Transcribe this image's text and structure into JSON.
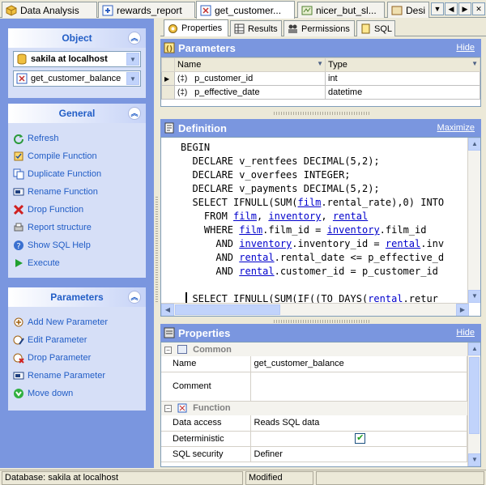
{
  "tabs": [
    {
      "label": "Data Analysis",
      "icon": "cube-icon"
    },
    {
      "label": "rewards_report",
      "icon": "procedure-icon"
    },
    {
      "label": "get_customer...",
      "icon": "function-icon",
      "active": true
    },
    {
      "label": "nicer_but_sl...",
      "icon": "view-icon"
    },
    {
      "label": "Desi",
      "icon": "designer-icon"
    }
  ],
  "sidebar": {
    "object": {
      "title": "Object",
      "database": "sakila at localhost",
      "function": "get_customer_balance"
    },
    "general": {
      "title": "General",
      "items": [
        {
          "label": "Refresh",
          "icon": "refresh-icon"
        },
        {
          "label": "Compile Function",
          "icon": "compile-icon"
        },
        {
          "label": "Duplicate Function",
          "icon": "duplicate-icon"
        },
        {
          "label": "Rename Function",
          "icon": "rename-icon"
        },
        {
          "label": "Drop Function",
          "icon": "drop-icon"
        },
        {
          "label": "Report structure",
          "icon": "report-icon"
        },
        {
          "label": "Show SQL Help",
          "icon": "help-icon"
        },
        {
          "label": "Execute",
          "icon": "execute-icon"
        }
      ]
    },
    "parameters": {
      "title": "Parameters",
      "items": [
        {
          "label": "Add New Parameter",
          "icon": "add-parameter-icon"
        },
        {
          "label": "Edit Parameter",
          "icon": "edit-parameter-icon"
        },
        {
          "label": "Drop Parameter",
          "icon": "drop-parameter-icon"
        },
        {
          "label": "Rename Parameter",
          "icon": "rename-parameter-icon"
        },
        {
          "label": "Move down",
          "icon": "move-down-icon"
        }
      ]
    }
  },
  "subtabs": [
    {
      "label": "Properties",
      "active": true
    },
    {
      "label": "Results"
    },
    {
      "label": "Permissions"
    },
    {
      "label": "SQL"
    }
  ],
  "parameters_section": {
    "title": "Parameters",
    "hide_label": "Hide",
    "columns": [
      "Name",
      "Type"
    ],
    "rows": [
      {
        "name": "p_customer_id",
        "type": "int"
      },
      {
        "name": "p_effective_date",
        "type": "datetime"
      }
    ]
  },
  "definition_section": {
    "title": "Definition",
    "maximize_label": "Maximize",
    "lines": [
      [
        {
          "t": "BEGIN"
        }
      ],
      [
        {
          "t": "  DECLARE v_rentfees DECIMAL(5,2);"
        }
      ],
      [
        {
          "t": "  DECLARE v_overfees INTEGER;"
        }
      ],
      [
        {
          "t": "  DECLARE v_payments DECIMAL(5,2);"
        }
      ],
      [
        {
          "t": "  SELECT IFNULL(SUM("
        },
        {
          "t": "film",
          "link": true
        },
        {
          "t": ".rental_rate),0) INTO"
        }
      ],
      [
        {
          "t": "    FROM "
        },
        {
          "t": "film",
          "link": true
        },
        {
          "t": ", "
        },
        {
          "t": "inventory",
          "link": true
        },
        {
          "t": ", "
        },
        {
          "t": "rental",
          "link": true
        }
      ],
      [
        {
          "t": "    WHERE "
        },
        {
          "t": "film",
          "link": true
        },
        {
          "t": ".film_id = "
        },
        {
          "t": "inventory",
          "link": true
        },
        {
          "t": ".film_id"
        }
      ],
      [
        {
          "t": "      AND "
        },
        {
          "t": "inventory",
          "link": true
        },
        {
          "t": ".inventory_id = "
        },
        {
          "t": "rental",
          "link": true
        },
        {
          "t": ".inv"
        }
      ],
      [
        {
          "t": "      AND "
        },
        {
          "t": "rental",
          "link": true
        },
        {
          "t": ".rental_date <= p_effective_d"
        }
      ],
      [
        {
          "t": "      AND "
        },
        {
          "t": "rental",
          "link": true
        },
        {
          "t": ".customer_id = p_customer_id"
        }
      ],
      [
        {
          "t": ""
        }
      ],
      [
        {
          "t": "  SELECT IFNULL(SUM(IF((TO DAYS("
        },
        {
          "t": "rental",
          "link": true
        },
        {
          "t": ".retur"
        }
      ]
    ]
  },
  "properties_section": {
    "title": "Properties",
    "hide_label": "Hide",
    "groups": [
      {
        "name": "Common",
        "rows": [
          {
            "label": "Name",
            "value": "get_customer_balance"
          },
          {
            "label": "Comment",
            "value": ""
          }
        ]
      },
      {
        "name": "Function",
        "rows": [
          {
            "label": "Data access",
            "value": "Reads SQL data"
          },
          {
            "label": "Deterministic",
            "value": "",
            "checked": true
          },
          {
            "label": "SQL security",
            "value": "Definer"
          }
        ]
      }
    ]
  },
  "status": {
    "database": "Database: sakila at localhost",
    "state": "Modified"
  },
  "colors": {
    "panel_blue": "#7a96df",
    "link_blue": "#215dc6",
    "code_link": "#0000cc"
  }
}
